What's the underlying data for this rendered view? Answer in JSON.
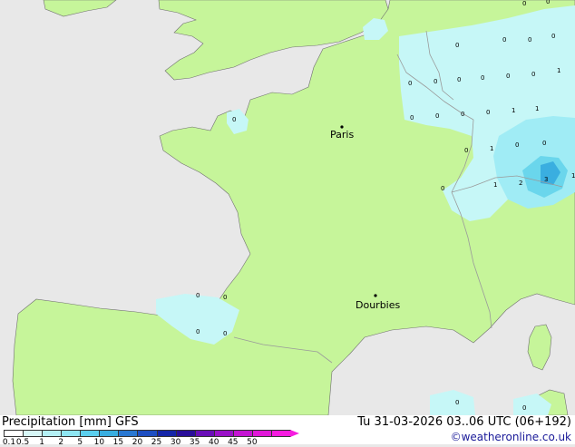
{
  "map": {
    "colors": {
      "sea": "#e8e8e8",
      "land": "#c6f59a",
      "precip_light": "#c6f7f7",
      "precip_med": "#a0ecf5",
      "precip_heavy": "#6ad6ec",
      "precip_strong": "#3aaee0",
      "border": "#9a9a9a",
      "coast": "#707070"
    },
    "cities": [
      {
        "name": "Paris"
      },
      {
        "name": "Dourbies"
      }
    ],
    "values": [
      "0",
      "0",
      "0",
      "0",
      "0",
      "0",
      "1",
      "0",
      "0",
      "0",
      "0",
      "0",
      "0",
      "0",
      "1",
      "1",
      "0",
      "0",
      "1",
      "0",
      "0",
      "1",
      "2",
      "3",
      "1",
      "0",
      "0",
      "0",
      "0",
      "0",
      "0",
      "0",
      "0",
      "0",
      "0"
    ]
  },
  "footer": {
    "product": "Precipitation [mm]  GFS",
    "runtime": "Tu 31-03-2026 03..06 UTC (06+192)",
    "credit": "©weatheronline.co.uk",
    "legend": {
      "colors": [
        "#ffffff",
        "#d7f7f7",
        "#b4f0f5",
        "#8ee6f2",
        "#5ccfee",
        "#3aaee0",
        "#2a78d2",
        "#1e4fc2",
        "#1526a8",
        "#2a0f9a",
        "#6a0fb8",
        "#9a12c8",
        "#c414d2",
        "#e018d8",
        "#f61ce0"
      ],
      "labels": [
        "0.1",
        "0.5",
        "1",
        "2",
        "5",
        "10",
        "15",
        "20",
        "25",
        "30",
        "35",
        "40",
        "45",
        "50"
      ]
    }
  }
}
